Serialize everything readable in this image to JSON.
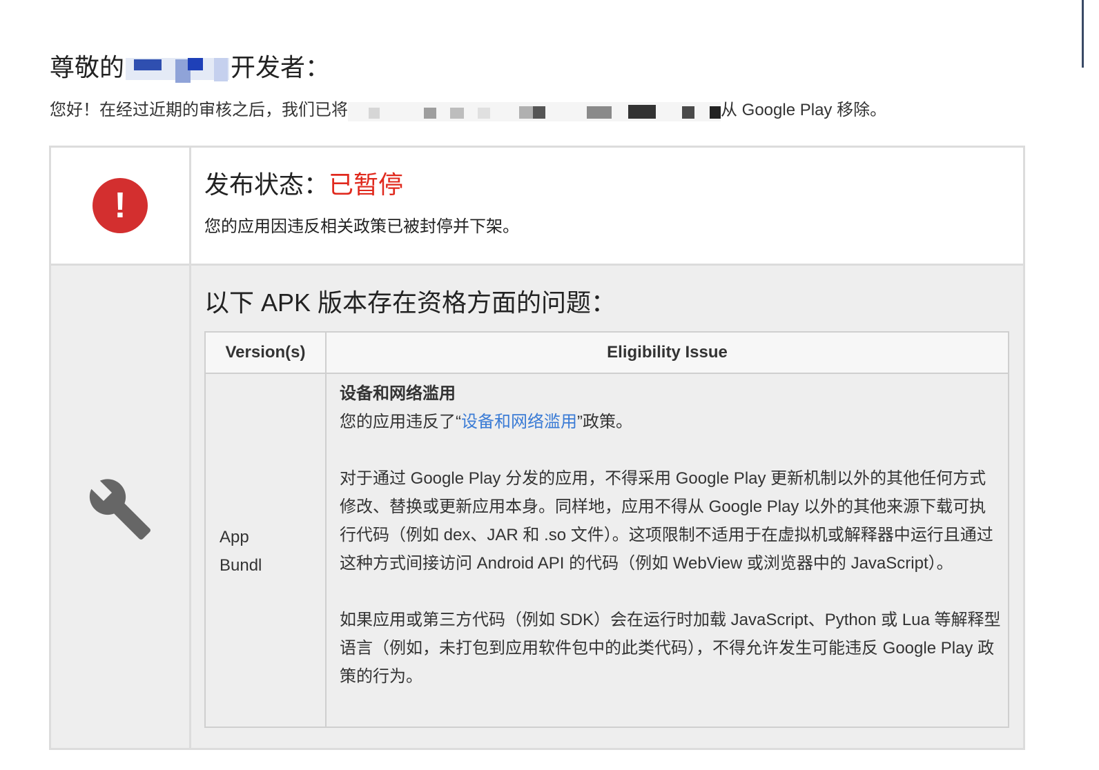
{
  "header": {
    "greeting_prefix": "尊敬的",
    "greeting_suffix": "开发者：",
    "intro_prefix": "您好！在经过近期的审核之后，我们已将",
    "intro_suffix": "从 Google Play 移除。"
  },
  "status": {
    "label": "发布状态：",
    "value": "已暂停",
    "description": "您的应用因违反相关政策已被封停并下架。",
    "icon": "alert-icon",
    "value_color": "#e0291d"
  },
  "issues": {
    "heading": "以下 APK 版本存在资格方面的问题：",
    "icon": "wrench-icon",
    "table": {
      "col_version": "Version(s)",
      "col_issue": "Eligibility Issue",
      "row": {
        "version_line1": "App",
        "version_line2": "Bundl",
        "issue_title": "设备和网络滥用",
        "violation_prefix": "您的应用违反了“",
        "violation_link": "设备和网络滥用",
        "violation_suffix": "”政策。",
        "paragraph1": "对于通过 Google Play 分发的应用，不得采用 Google Play 更新机制以外的其他任何方式修改、替换或更新应用本身。同样地，应用不得从 Google Play 以外的其他来源下载可执行代码（例如 dex、JAR 和 .so 文件）。这项限制不适用于在虚拟机或解释器中运行且通过这种方式间接访问 Android API 的代码（例如 WebView 或浏览器中的 JavaScript）。",
        "paragraph2": "如果应用或第三方代码（例如 SDK）会在运行时加载 JavaScript、Python 或 Lua 等解释型语言（例如，未打包到应用软件包中的此类代码），不得允许发生可能违反 Google Play 政策的行为。"
      }
    }
  },
  "colors": {
    "link": "#3a7bd5",
    "alert": "#d32f2f",
    "border": "#dcdcdc",
    "issue_bg": "#eeeeee"
  }
}
